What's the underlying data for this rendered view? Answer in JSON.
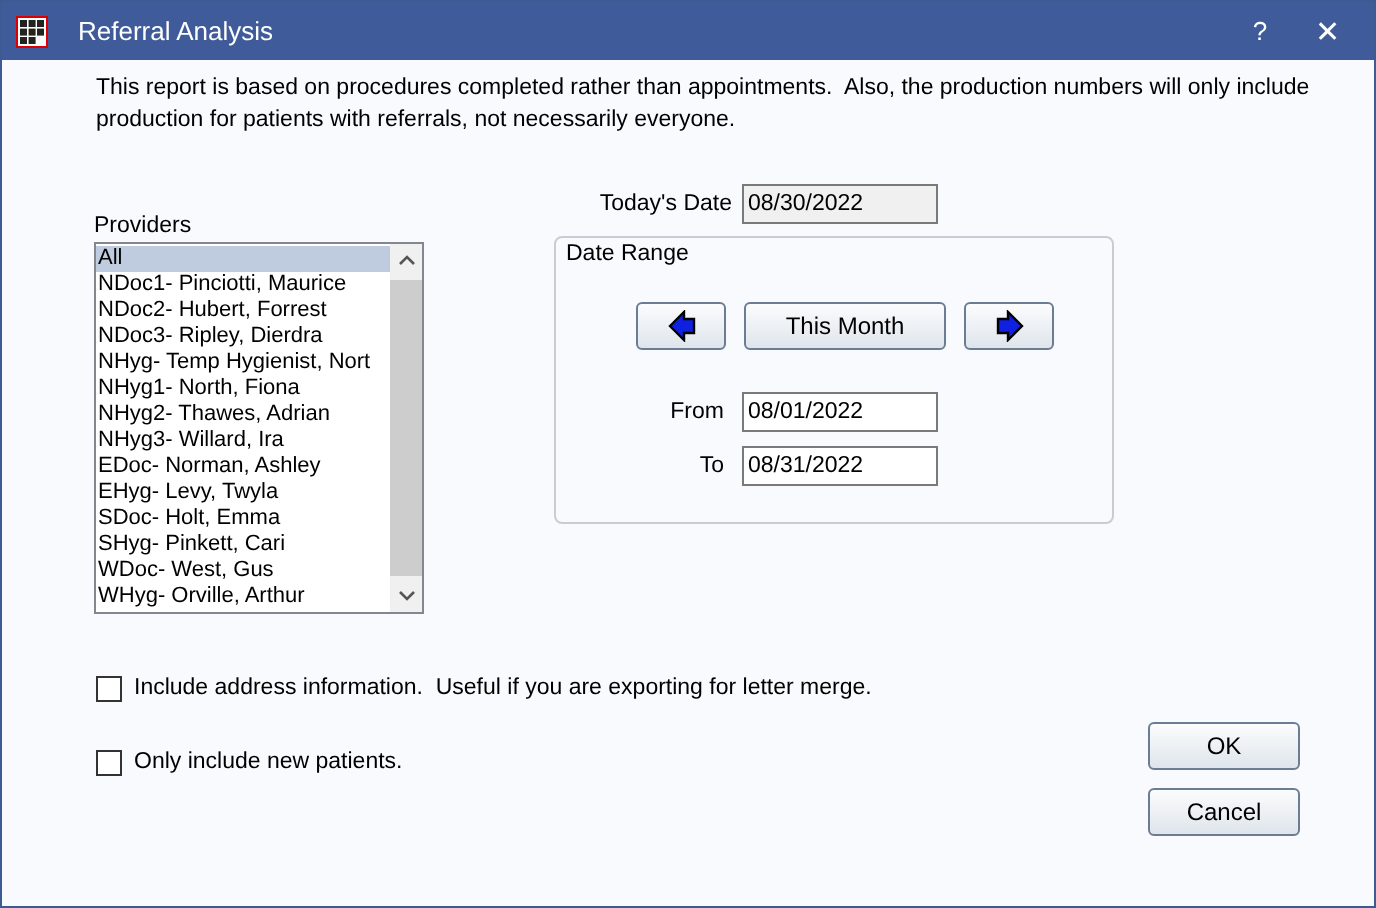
{
  "window": {
    "title": "Referral Analysis",
    "help": "?",
    "close": "✕"
  },
  "description": "This report is based on procedures completed rather than appointments.  Also, the production numbers will only include production for patients with referrals, not necessarily everyone.",
  "providers": {
    "label": "Providers",
    "items": [
      {
        "text": "All",
        "selected": true
      },
      {
        "text": "NDoc1- Pinciotti, Maurice",
        "selected": false
      },
      {
        "text": "NDoc2- Hubert, Forrest",
        "selected": false
      },
      {
        "text": "NDoc3- Ripley, Dierdra",
        "selected": false
      },
      {
        "text": "NHyg- Temp Hygienist, Nort",
        "selected": false
      },
      {
        "text": "NHyg1- North, Fiona",
        "selected": false
      },
      {
        "text": "NHyg2- Thawes, Adrian",
        "selected": false
      },
      {
        "text": "NHyg3- Willard, Ira",
        "selected": false
      },
      {
        "text": "EDoc- Norman, Ashley",
        "selected": false
      },
      {
        "text": "EHyg- Levy, Twyla",
        "selected": false
      },
      {
        "text": "SDoc- Holt, Emma",
        "selected": false
      },
      {
        "text": "SHyg- Pinkett, Cari",
        "selected": false
      },
      {
        "text": "WDoc- West, Gus",
        "selected": false
      },
      {
        "text": "WHyg- Orville, Arthur",
        "selected": false
      }
    ]
  },
  "todays_date": {
    "label": "Today's Date",
    "value": "08/30/2022"
  },
  "date_range": {
    "title": "Date Range",
    "this_month": "This Month",
    "from": {
      "label": "From",
      "value": "08/01/2022"
    },
    "to": {
      "label": "To",
      "value": "08/31/2022"
    }
  },
  "options": [
    {
      "label": "Include address information.  Useful if you are exporting for letter merge.",
      "checked": false
    },
    {
      "label": "Only include new patients.",
      "checked": false
    }
  ],
  "buttons": [
    "OK",
    "Cancel"
  ]
}
